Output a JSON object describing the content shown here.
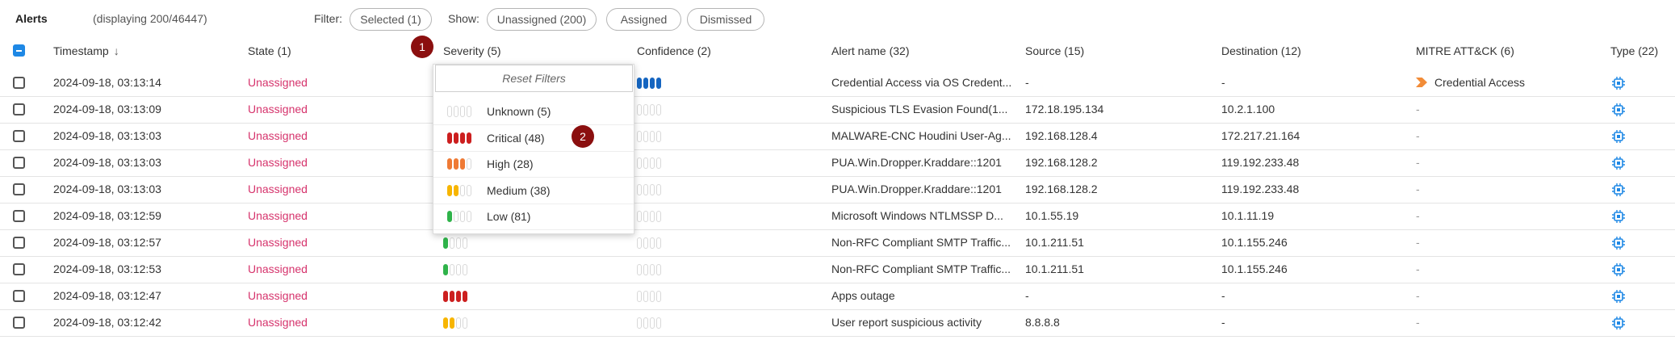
{
  "topbar": {
    "title": "Alerts",
    "count": "(displaying 200/46447)",
    "filter_label": "Filter:",
    "filter_pill": "Selected (1)",
    "show_label": "Show:",
    "show_pills": [
      "Unassigned (200)",
      "Assigned",
      "Dismissed"
    ]
  },
  "columns": {
    "timestamp": "Timestamp",
    "state": "State (1)",
    "severity": "Severity (5)",
    "confidence": "Confidence (2)",
    "alert_name": "Alert name (32)",
    "source": "Source (15)",
    "destination": "Destination (12)",
    "mitre": "MITRE ATT&CK (6)",
    "type": "Type (22)"
  },
  "severity_colors": {
    "critical": "#cc1f1f",
    "high": "#ef7a35",
    "medium": "#f7b500",
    "low": "#2fb34a",
    "confidence": "#1565c0",
    "empty": "#ffffff",
    "state_unassigned": "#d6336c",
    "type_icon": "#1e88e5"
  },
  "rows": [
    {
      "timestamp": "2024-09-18, 03:13:14",
      "state": "Unassigned",
      "severity": "",
      "confidence": 4,
      "alert_name": "Credential Access via OS Credent...",
      "source": "-",
      "destination": "-",
      "mitre": "Credential Access",
      "type_icon": "chip-icon"
    },
    {
      "timestamp": "2024-09-18, 03:13:09",
      "state": "Unassigned",
      "severity": "",
      "confidence": 0,
      "alert_name": "Suspicious TLS Evasion Found(1...",
      "source": "172.18.195.134",
      "destination": "10.2.1.100",
      "mitre": "-",
      "type_icon": "chip-icon"
    },
    {
      "timestamp": "2024-09-18, 03:13:03",
      "state": "Unassigned",
      "severity": "",
      "confidence": 0,
      "alert_name": "MALWARE-CNC Houdini User-Ag...",
      "source": "192.168.128.4",
      "destination": "172.217.21.164",
      "mitre": "-",
      "type_icon": "chip-icon"
    },
    {
      "timestamp": "2024-09-18, 03:13:03",
      "state": "Unassigned",
      "severity": "",
      "confidence": 0,
      "alert_name": "PUA.Win.Dropper.Kraddare::1201",
      "source": "192.168.128.2",
      "destination": "119.192.233.48",
      "mitre": "-",
      "type_icon": "chip-icon"
    },
    {
      "timestamp": "2024-09-18, 03:13:03",
      "state": "Unassigned",
      "severity": "",
      "confidence": 0,
      "alert_name": "PUA.Win.Dropper.Kraddare::1201",
      "source": "192.168.128.2",
      "destination": "119.192.233.48",
      "mitre": "-",
      "type_icon": "chip-icon"
    },
    {
      "timestamp": "2024-09-18, 03:12:59",
      "state": "Unassigned",
      "severity": "",
      "confidence": 0,
      "alert_name": "Microsoft Windows NTLMSSP D...",
      "source": "10.1.55.19",
      "destination": "10.1.11.19",
      "mitre": "-",
      "type_icon": "chip-icon"
    },
    {
      "timestamp": "2024-09-18, 03:12:57",
      "state": "Unassigned",
      "severity": "low",
      "confidence": 0,
      "alert_name": "Non-RFC Compliant SMTP Traffic...",
      "source": "10.1.211.51",
      "destination": "10.1.155.246",
      "mitre": "-",
      "type_icon": "chip-icon"
    },
    {
      "timestamp": "2024-09-18, 03:12:53",
      "state": "Unassigned",
      "severity": "low",
      "confidence": 0,
      "alert_name": "Non-RFC Compliant SMTP Traffic...",
      "source": "10.1.211.51",
      "destination": "10.1.155.246",
      "mitre": "-",
      "type_icon": "chip-icon"
    },
    {
      "timestamp": "2024-09-18, 03:12:47",
      "state": "Unassigned",
      "severity": "critical",
      "confidence": 0,
      "alert_name": "Apps outage",
      "source": "-",
      "destination": "-",
      "mitre": "-",
      "type_icon": "chip-icon"
    },
    {
      "timestamp": "2024-09-18, 03:12:42",
      "state": "Unassigned",
      "severity": "medium",
      "confidence": 0,
      "alert_name": "User report suspicious activity",
      "source": "8.8.8.8",
      "destination": "-",
      "mitre": "-",
      "type_icon": "chip-icon"
    }
  ],
  "dropdown": {
    "reset_label": "Reset Filters",
    "options": [
      {
        "label": "Unknown (5)",
        "level": "unknown"
      },
      {
        "label": "Critical (48)",
        "level": "critical"
      },
      {
        "label": "High (28)",
        "level": "high"
      },
      {
        "label": "Medium (38)",
        "level": "medium"
      },
      {
        "label": "Low (81)",
        "level": "low"
      }
    ]
  },
  "badges": [
    "1",
    "2"
  ]
}
